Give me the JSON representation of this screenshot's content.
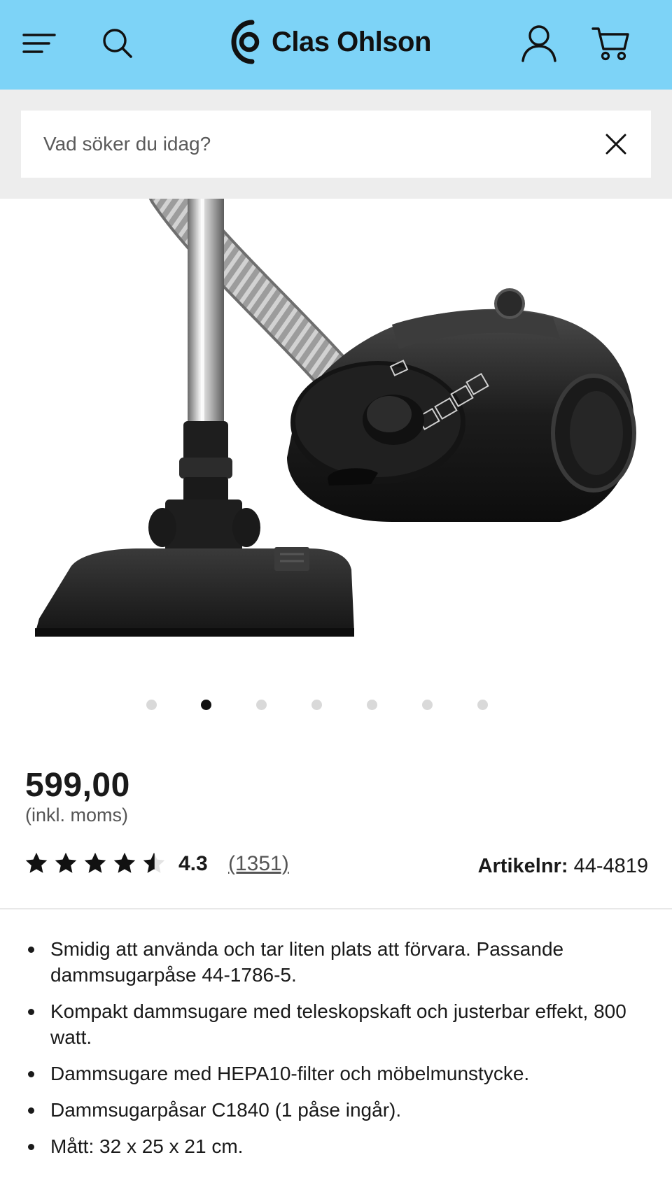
{
  "header": {
    "brand": "Clas Ohlson",
    "background": "#7dd3f7",
    "icons": [
      "menu-icon",
      "search-icon",
      "user-icon",
      "cart-icon"
    ]
  },
  "search": {
    "placeholder": "Vad söker du idag?",
    "value": ""
  },
  "gallery": {
    "image_count": 7,
    "active_index": 1
  },
  "product": {
    "price": "599,00",
    "vat_note": "(inkl. moms)",
    "rating": 4.3,
    "rating_text": "4.3",
    "reviews": "(1351)",
    "article_label": "Artikelnr:",
    "article_number": "44-4819"
  },
  "features": [
    "Smidig att använda och tar liten plats att förvara. Passande dammsugarpåse 44-1786-5.",
    "Kompakt dammsugare med teleskopskaft och justerbar effekt, 800 watt.",
    "Dammsugare med HEPA10-filter och möbelmunstycke.",
    "Dammsugarpåsar C1840 (1 påse ingår).",
    "Mått: 32 x 25 x 21 cm."
  ]
}
